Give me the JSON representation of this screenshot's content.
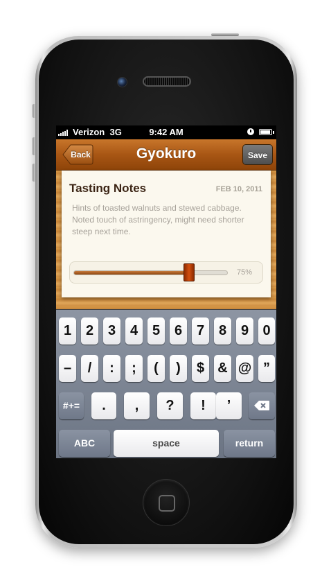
{
  "status_bar": {
    "carrier": "Verizon",
    "network": "3G",
    "time": "9:42 AM"
  },
  "nav": {
    "back_label": "Back",
    "title": "Gyokuro",
    "save_label": "Save"
  },
  "card": {
    "title": "Tasting Notes",
    "date": "FEB 10, 2011",
    "notes": "Hints of toasted walnuts and stewed cabbage. Noted  touch of astringency, might need shorter steep next time.",
    "slider_value": 75,
    "slider_label": "75%"
  },
  "keyboard": {
    "row1": [
      "1",
      "2",
      "3",
      "4",
      "5",
      "6",
      "7",
      "8",
      "9",
      "0"
    ],
    "row2": [
      "–",
      "/",
      ":",
      ";",
      "(",
      ")",
      "$",
      "&",
      "@",
      "”"
    ],
    "row3": {
      "shift_label": "#+=",
      "keys": [
        ".",
        ",",
        "?",
        "!",
        "’"
      ],
      "delete_icon": "delete-icon"
    },
    "row4": {
      "abc_label": "ABC",
      "space_label": "space",
      "return_label": "return"
    }
  },
  "colors": {
    "nav_brown": "#a85614",
    "card_bg": "#fbf8ee",
    "slider_thumb": "#d24e0e"
  }
}
